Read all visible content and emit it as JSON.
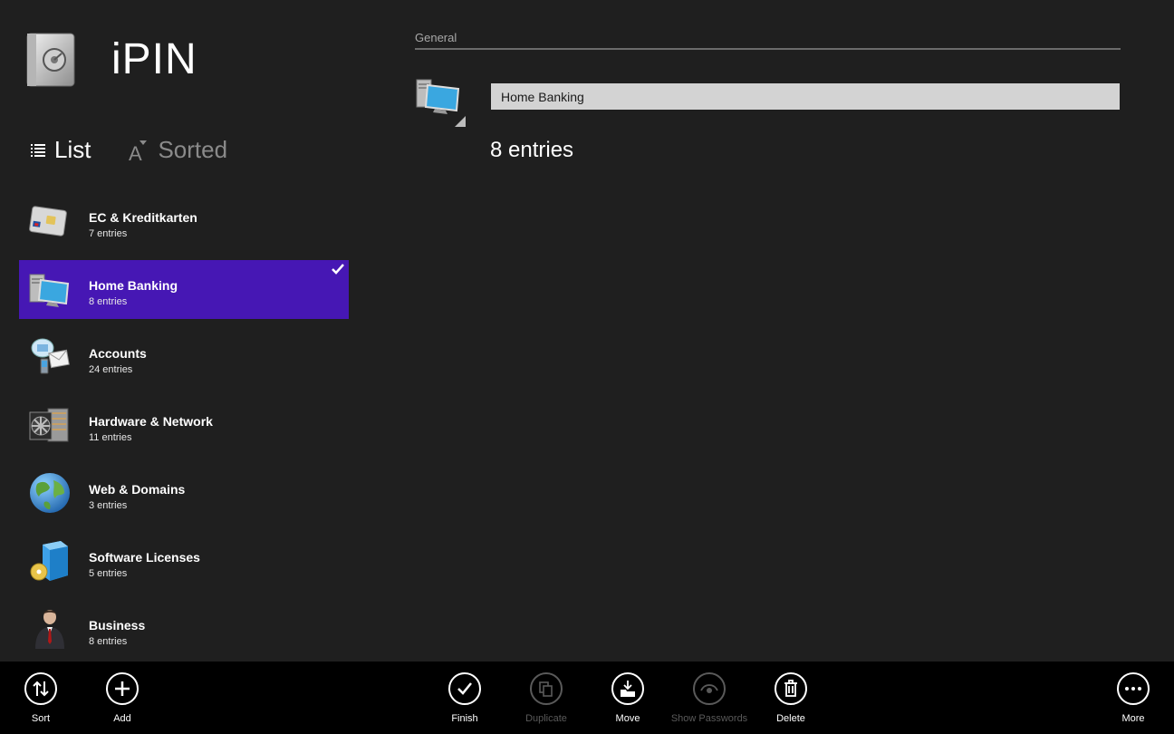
{
  "app": {
    "title": "iPIN"
  },
  "view": {
    "list_label": "List",
    "sort_label": "Sorted"
  },
  "categories": [
    {
      "name": "EC & Kreditkarten",
      "count": "7 entries",
      "icon": "credit-card-icon"
    },
    {
      "name": "Home Banking",
      "count": "8 entries",
      "icon": "computer-icon",
      "selected": true
    },
    {
      "name": "Accounts",
      "count": "24 entries",
      "icon": "accounts-icon"
    },
    {
      "name": "Hardware & Network",
      "count": "11 entries",
      "icon": "hardware-icon"
    },
    {
      "name": "Web & Domains",
      "count": "3 entries",
      "icon": "globe-icon"
    },
    {
      "name": "Software Licenses",
      "count": "5 entries",
      "icon": "software-box-icon"
    },
    {
      "name": "Business",
      "count": "8 entries",
      "icon": "businessman-icon"
    }
  ],
  "detail": {
    "group_label": "General",
    "name_value": "Home Banking",
    "count": "8 entries"
  },
  "appbar": {
    "sort": "Sort",
    "add": "Add",
    "finish": "Finish",
    "duplicate": "Duplicate",
    "move": "Move",
    "show_passwords": "Show Passwords",
    "delete": "Delete",
    "more": "More"
  },
  "colors": {
    "background": "#1f1f1f",
    "selection": "#4617b4",
    "appbar": "#000000",
    "field": "#d3d3d3"
  }
}
